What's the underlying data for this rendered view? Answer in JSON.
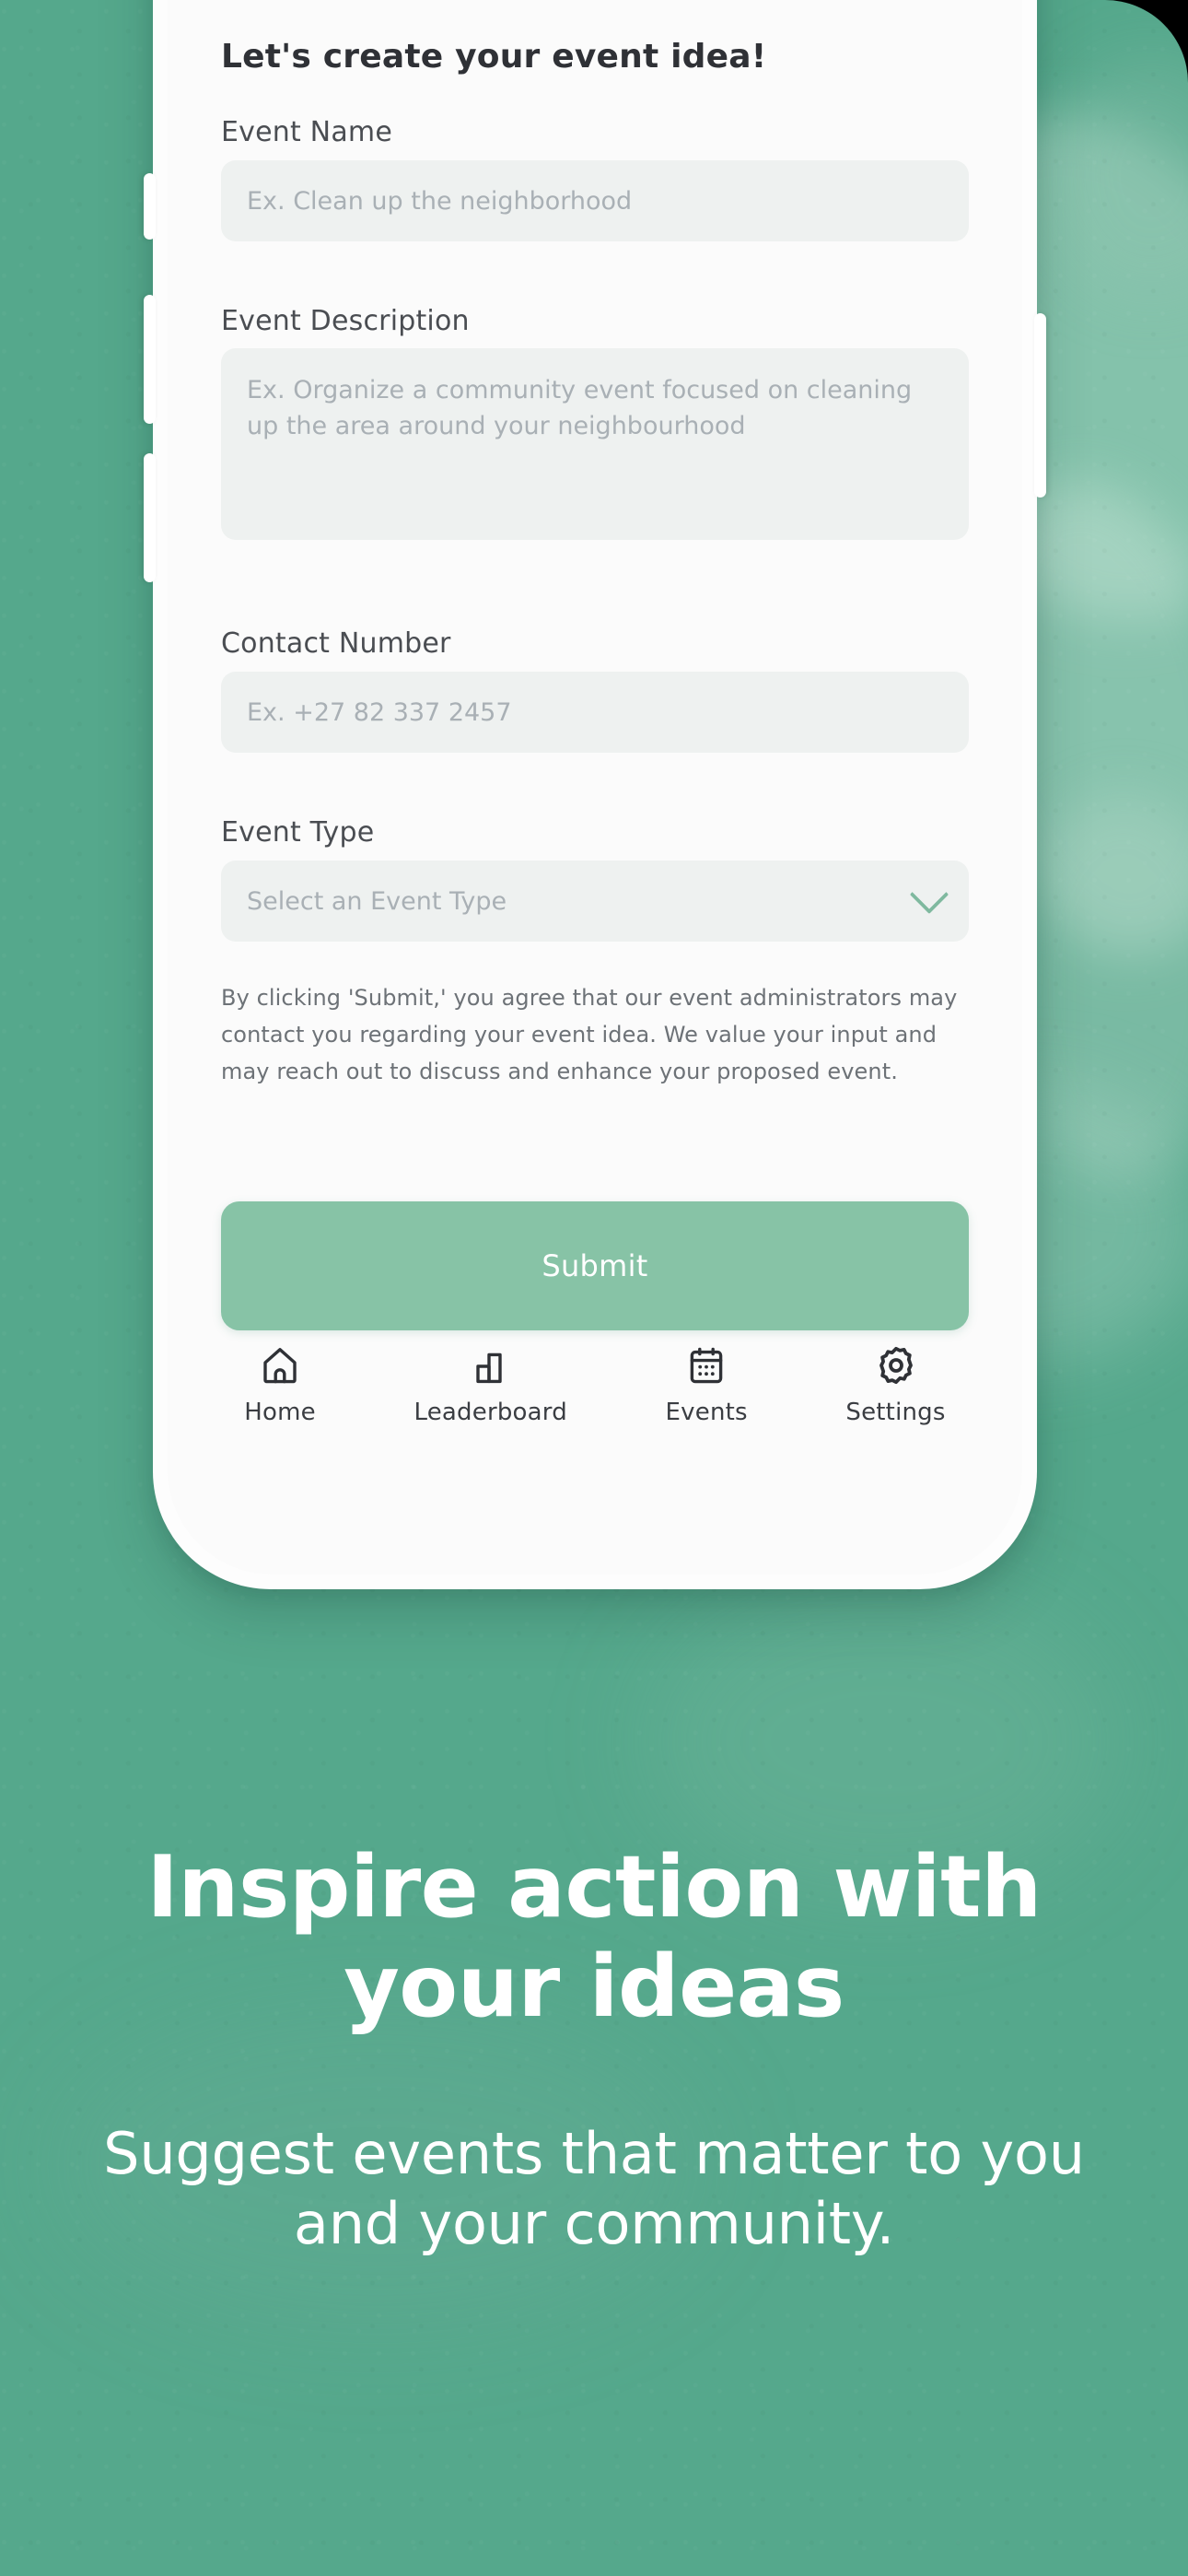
{
  "colors": {
    "background_green": "#55a88c",
    "submit_button": "#87c3a6",
    "input_fill": "#eef1f0",
    "phone_body": "#fdfdfd",
    "placeholder_text": "#a9b0b5",
    "marketing_text": "#ffffff"
  },
  "form": {
    "title": "Let's create your event idea!",
    "fields": [
      {
        "label": "Event Name",
        "placeholder": "Ex. Clean up the neighborhood",
        "value": "",
        "type": "text"
      },
      {
        "label": "Event Description",
        "placeholder": "Ex. Organize a community event focused on cleaning up the area around your neighbourhood",
        "value": "",
        "type": "textarea"
      },
      {
        "label": "Contact Number",
        "placeholder": "Ex. +27 82 337 2457",
        "value": "",
        "type": "tel"
      },
      {
        "label": "Event Type",
        "placeholder": "Select an Event Type",
        "value": "",
        "type": "select"
      }
    ],
    "disclaimer": "By clicking 'Submit,' you agree that our event administrators may contact you regarding your event idea. We value your input and may reach out to discuss and enhance your proposed event.",
    "submit_label": "Submit"
  },
  "bottom_nav": {
    "items": [
      {
        "label": "Home",
        "icon": "home-icon"
      },
      {
        "label": "Leaderboard",
        "icon": "bar-chart-icon"
      },
      {
        "label": "Events",
        "icon": "calendar-icon"
      },
      {
        "label": "Settings",
        "icon": "gear-icon"
      }
    ]
  },
  "marketing": {
    "headline": "Inspire action with your ideas",
    "subheadline": "Suggest events that matter to you and your community."
  }
}
